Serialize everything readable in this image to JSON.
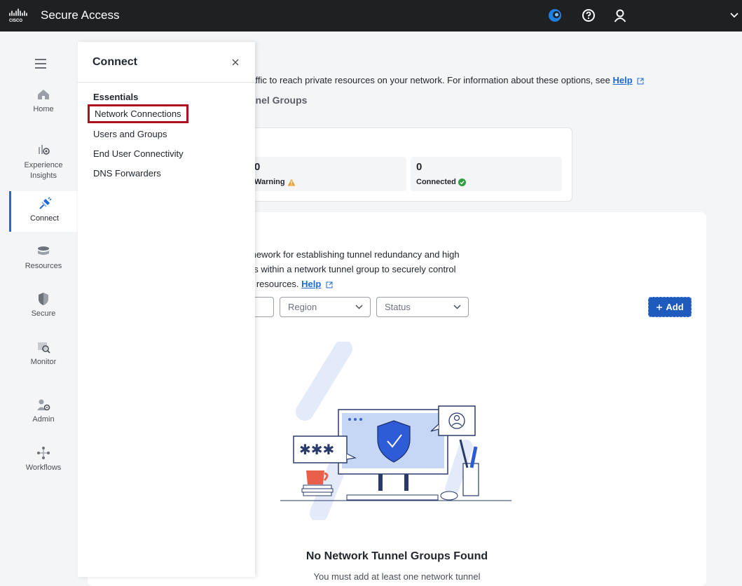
{
  "header": {
    "app_title": "Secure Access",
    "icons": [
      "cisco-logo",
      "assistant-icon",
      "help-icon",
      "user-icon",
      "chevron-down-icon"
    ]
  },
  "sidebar": {
    "items": [
      {
        "label": "Home",
        "icon": "home-icon"
      },
      {
        "label": "Experience Insights",
        "icon": "insights-icon"
      },
      {
        "label": "Connect",
        "icon": "connect-icon"
      },
      {
        "label": "Resources",
        "icon": "resources-icon"
      },
      {
        "label": "Secure",
        "icon": "shield-icon"
      },
      {
        "label": "Monitor",
        "icon": "monitor-icon"
      },
      {
        "label": "Admin",
        "icon": "admin-icon"
      },
      {
        "label": "Workflows",
        "icon": "workflows-icon"
      }
    ],
    "active": "Connect"
  },
  "main": {
    "intro_text": "raffic to reach private resources on your network. For information about these options, see",
    "intro_link": "Help",
    "section_title": "nnel Groups",
    "stats": [
      {
        "value": "0",
        "label": "Warning"
      },
      {
        "value": "0",
        "label": "Connected"
      }
    ],
    "description_lines": [
      "mework for establishing tunnel redundancy and high",
      "ps within a network tunnel group to securely control",
      "e resources."
    ],
    "description_link": "Help",
    "filters": {
      "region_placeholder": "Region",
      "status_placeholder": "Status"
    },
    "add_label": "Add",
    "empty_title": "No Network Tunnel Groups Found",
    "empty_subtitle": "You must add at least one network tunnel"
  },
  "flyout": {
    "title": "Connect",
    "section": "Essentials",
    "items": [
      "Network Connections",
      "Users and Groups",
      "End User Connectivity",
      "DNS Forwarders"
    ],
    "highlighted_item": "Network Connections"
  },
  "colors": {
    "topbar": "#1e2022",
    "accent": "#1e6ad6",
    "add_button": "#1e5bbd",
    "highlight_border": "#b0101e",
    "warning": "#e8a33d",
    "success": "#2e9e3f"
  }
}
